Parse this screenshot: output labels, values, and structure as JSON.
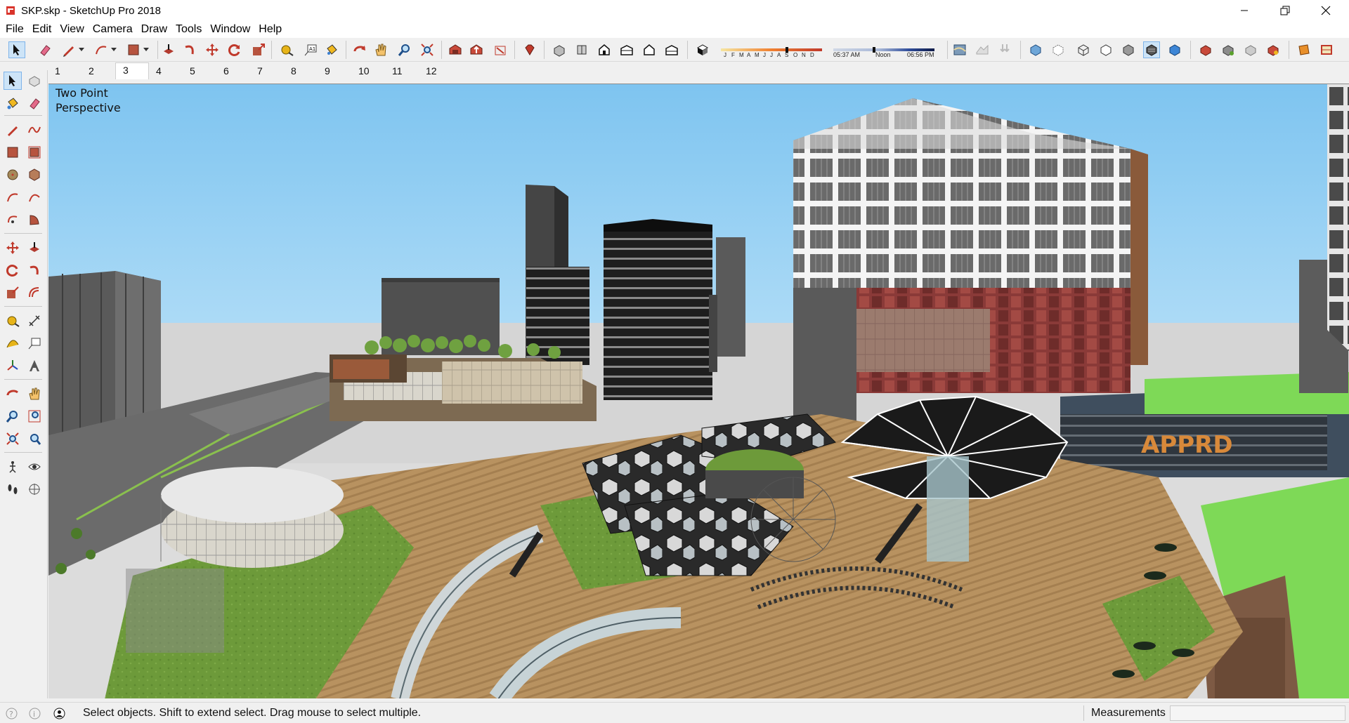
{
  "window": {
    "title": "SKP.skp - SketchUp Pro 2018",
    "app_icon": "sketchup-logo-icon",
    "controls": [
      "minimize-icon",
      "restore-icon",
      "close-icon"
    ]
  },
  "menu": {
    "items": [
      "File",
      "Edit",
      "View",
      "Camera",
      "Draw",
      "Tools",
      "Window",
      "Help"
    ]
  },
  "toolbar": {
    "shadow": {
      "months": [
        "J",
        "F",
        "M",
        "A",
        "M",
        "J",
        "J",
        "A",
        "S",
        "O",
        "N",
        "D"
      ],
      "sunrise": "05:37 AM",
      "noon": "Noon",
      "sunset": "06:56 PM"
    }
  },
  "scenes": {
    "tabs": [
      "1",
      "2",
      "3",
      "4",
      "5",
      "6",
      "7",
      "8",
      "9",
      "10",
      "11",
      "12"
    ],
    "selected": "3"
  },
  "viewport": {
    "camera_label": "Two Point\nPerspective",
    "sign_text": "APPRD"
  },
  "statusbar": {
    "hint": "Select objects. Shift to extend select. Drag mouse to select multiple.",
    "measurements_label": "Measurements",
    "measurements_value": ""
  },
  "colors": {
    "sky": "#a6d6f4",
    "grass": "#6d9a3a",
    "deck": "#b89260",
    "tower_red": "#8a3a38",
    "bright_green": "#7ed957",
    "select_highlight": "#cde4f7"
  }
}
